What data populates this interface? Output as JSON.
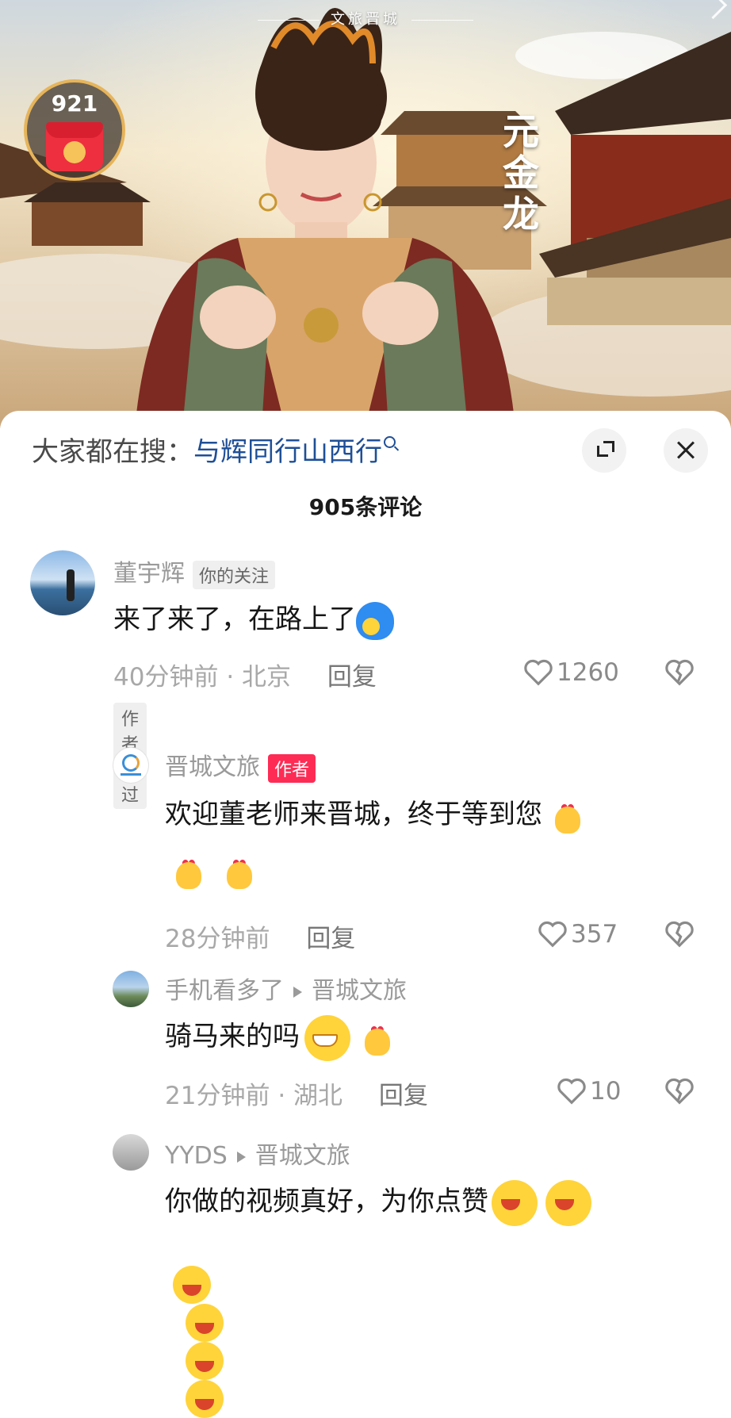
{
  "video": {
    "brand": "文旅晋城",
    "caption": "元金龙",
    "red_packet_count": "921"
  },
  "search": {
    "prefix": "大家都在搜：",
    "keyword": "与辉同行山西行"
  },
  "comment_count": "905条评论",
  "comments": [
    {
      "user": "董宇辉",
      "tag": "你的关注",
      "text": "来了来了，在路上了",
      "time": "40分钟前",
      "sep": "·",
      "location": "北京",
      "reply": "回复",
      "likes": "1260",
      "author_liked": "作者赞过"
    },
    {
      "user": "晋城文旅",
      "tag": "作者",
      "text_line1": "欢迎董老师来晋城，终于等到您",
      "time": "28分钟前",
      "reply": "回复",
      "likes": "357"
    },
    {
      "user": "手机看多了",
      "reply_to": "晋城文旅",
      "text": "骑马来的吗",
      "time": "21分钟前",
      "sep": "·",
      "location": "湖北",
      "reply": "回复",
      "likes": "10"
    },
    {
      "user": "YYDS",
      "reply_to": "晋城文旅",
      "text": "你做的视频真好，为你点赞"
    }
  ],
  "icons": {
    "like": "heart-outline-icon",
    "dislike": "broken-heart-icon",
    "expand": "expand-icon",
    "close": "close-icon",
    "search": "search-icon"
  }
}
